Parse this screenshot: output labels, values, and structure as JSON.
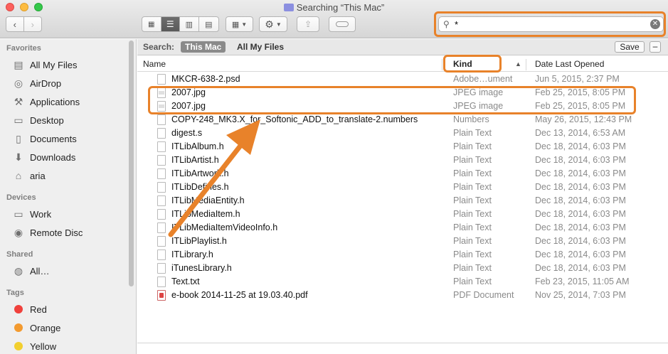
{
  "window": {
    "title": "Searching “This Mac”"
  },
  "toolbar": {
    "view_icons": [
      "icon-view-icon",
      "list-view-icon",
      "column-view-icon",
      "coverflow-view-icon"
    ],
    "arrange_icon": "arrange-icon",
    "action_icon": "gear-icon",
    "share_icon": "share-icon",
    "tag_icon": "tag-icon"
  },
  "search": {
    "value": "*"
  },
  "sidebar": {
    "favorites_title": "Favorites",
    "favorites": [
      {
        "label": "All My Files",
        "icon": "all-files-icon"
      },
      {
        "label": "AirDrop",
        "icon": "airdrop-icon"
      },
      {
        "label": "Applications",
        "icon": "applications-icon"
      },
      {
        "label": "Desktop",
        "icon": "desktop-icon"
      },
      {
        "label": "Documents",
        "icon": "documents-icon"
      },
      {
        "label": "Downloads",
        "icon": "downloads-icon"
      },
      {
        "label": "aria",
        "icon": "home-icon"
      }
    ],
    "devices_title": "Devices",
    "devices": [
      {
        "label": "Work",
        "icon": "disk-icon"
      },
      {
        "label": "Remote Disc",
        "icon": "disc-icon"
      }
    ],
    "shared_title": "Shared",
    "shared": [
      {
        "label": "All…",
        "icon": "network-icon"
      }
    ],
    "tags_title": "Tags",
    "tags": [
      {
        "label": "Red",
        "color": "#f0413c"
      },
      {
        "label": "Orange",
        "color": "#f39a2f"
      },
      {
        "label": "Yellow",
        "color": "#f2cf2e"
      }
    ]
  },
  "scope": {
    "label": "Search:",
    "this_mac": "This Mac",
    "all_files": "All My Files",
    "save": "Save",
    "minus": "–"
  },
  "columns": {
    "name": "Name",
    "kind": "Kind",
    "date": "Date Last Opened"
  },
  "files": [
    {
      "name": "MKCR-638-2.psd",
      "kind": "Adobe…ument",
      "date": "Jun 5, 2015, 2:37 PM",
      "icon": "doc"
    },
    {
      "name": "2007.jpg",
      "kind": "JPEG image",
      "date": "Feb 25, 2015, 8:05 PM",
      "icon": "img"
    },
    {
      "name": "2007.jpg",
      "kind": "JPEG image",
      "date": "Feb 25, 2015, 8:05 PM",
      "icon": "img"
    },
    {
      "name": "COPY-248_MK3.X_for_Softonic_ADD_to_translate-2.numbers",
      "kind": "Numbers",
      "date": "May 26, 2015, 12:43 PM",
      "icon": "doc"
    },
    {
      "name": "digest.s",
      "kind": "Plain Text",
      "date": "Dec 13, 2014, 6:53 AM",
      "icon": "doc"
    },
    {
      "name": "ITLibAlbum.h",
      "kind": "Plain Text",
      "date": "Dec 18, 2014, 6:03 PM",
      "icon": "doc"
    },
    {
      "name": "ITLibArtist.h",
      "kind": "Plain Text",
      "date": "Dec 18, 2014, 6:03 PM",
      "icon": "doc"
    },
    {
      "name": "ITLibArtwork.h",
      "kind": "Plain Text",
      "date": "Dec 18, 2014, 6:03 PM",
      "icon": "doc"
    },
    {
      "name": "ITLibDefines.h",
      "kind": "Plain Text",
      "date": "Dec 18, 2014, 6:03 PM",
      "icon": "doc"
    },
    {
      "name": "ITLibMediaEntity.h",
      "kind": "Plain Text",
      "date": "Dec 18, 2014, 6:03 PM",
      "icon": "doc"
    },
    {
      "name": "ITLibMediaItem.h",
      "kind": "Plain Text",
      "date": "Dec 18, 2014, 6:03 PM",
      "icon": "doc"
    },
    {
      "name": "ITLibMediaItemVideoInfo.h",
      "kind": "Plain Text",
      "date": "Dec 18, 2014, 6:03 PM",
      "icon": "doc"
    },
    {
      "name": "ITLibPlaylist.h",
      "kind": "Plain Text",
      "date": "Dec 18, 2014, 6:03 PM",
      "icon": "doc"
    },
    {
      "name": "ITLibrary.h",
      "kind": "Plain Text",
      "date": "Dec 18, 2014, 6:03 PM",
      "icon": "doc"
    },
    {
      "name": "iTunesLibrary.h",
      "kind": "Plain Text",
      "date": "Dec 18, 2014, 6:03 PM",
      "icon": "doc"
    },
    {
      "name": "Text.txt",
      "kind": "Plain Text",
      "date": "Feb 23, 2015, 11:05 AM",
      "icon": "doc"
    },
    {
      "name": "e-book 2014-11-25 at 19.03.40.pdf",
      "kind": "PDF Document",
      "date": "Nov 25, 2014, 7:03 PM",
      "icon": "pdf"
    }
  ],
  "colors": {
    "highlight": "#e8822a",
    "sidebar_bg": "#efefef"
  }
}
